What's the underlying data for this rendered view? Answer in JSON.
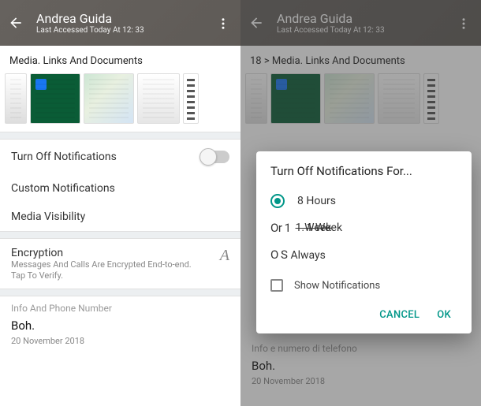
{
  "left": {
    "header": {
      "title": "Andrea Guida",
      "subtitle": "Last Accessed Today At 12: 33"
    },
    "media_section_label": "Media. Links And Documents",
    "rows": {
      "turn_off": "Turn Off Notifications",
      "custom": "Custom Notifications",
      "media_vis": "Media Visibility"
    },
    "encryption": {
      "title": "Encryption",
      "desc": "Messages And Calls Are Encrypted End-to-end. Tap To Verify."
    },
    "info": {
      "label": "Info And Phone Number",
      "value": "Boh.",
      "date": "20 November 2018"
    }
  },
  "right": {
    "header": {
      "title": "Andrea Guida",
      "subtitle": "Last Accessed Today At 12: 33"
    },
    "breadcrumb": "18 > Media. Links And Documents",
    "info_bg": {
      "label": "Info e numero di telefono",
      "value": "Boh.",
      "date": "20 November 2018"
    },
    "dialog": {
      "title": "Turn Off Notifications For...",
      "options": {
        "opt1": "8 Hours",
        "opt2_prefix": "Or 1",
        "opt2_label": "1 Week",
        "opt3_prefix": "O S",
        "opt3_label": "Always"
      },
      "show_notifications": "Show Notifications",
      "cancel": "CANCEL",
      "ok": "OK"
    }
  }
}
